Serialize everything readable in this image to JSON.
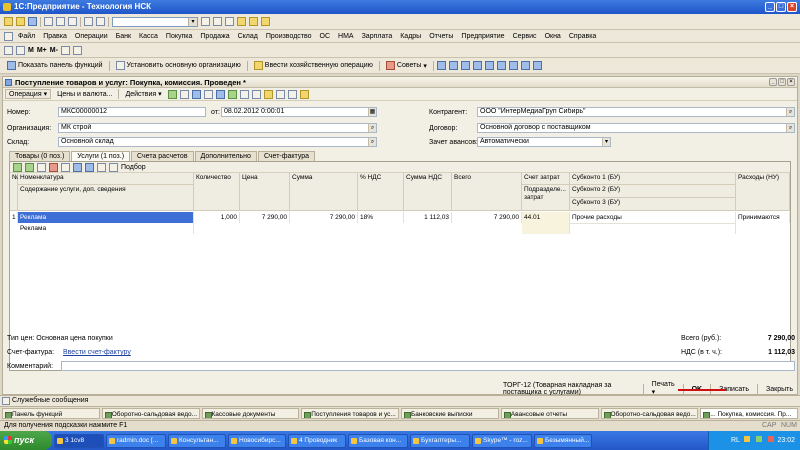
{
  "app": {
    "title": "1С:Предприятие - Технология НСК"
  },
  "menu": [
    "Файл",
    "Правка",
    "Операции",
    "Банк",
    "Касса",
    "Покупка",
    "Продажа",
    "Склад",
    "Производство",
    "ОС",
    "НМА",
    "Зарплата",
    "Кадры",
    "Отчеты",
    "Предприятие",
    "Сервис",
    "Окна",
    "Справка"
  ],
  "toolbar3": {
    "show_panel": "Показать панель функций",
    "main_org": "Установить основную организацию",
    "enter_op": "Ввести хозяйственную операцию",
    "tips": "Советы"
  },
  "doc": {
    "title": "Поступление товаров и услуг: Покупка, комиссия. Проведен *",
    "toolbar": {
      "operation": "Операция",
      "prices": "Цены и валюта...",
      "actions": "Действия"
    },
    "labels": {
      "number": "Номер:",
      "from": "от:",
      "org": "Организация:",
      "warehouse": "Склад:",
      "contractor": "Контрагент:",
      "contract": "Договор:",
      "advance": "Зачет авансов:"
    },
    "values": {
      "number": "МКС00000012",
      "date": "08.02.2012  0:00:01",
      "org": "МК строй",
      "warehouse": "Основной склад",
      "contractor": "ООО \"ИнтерМедиаГруп Сибирь\"",
      "contract": "Основной договор с поставщиком",
      "advance": "Автоматически"
    },
    "tabs": [
      "Товары (0 поз.)",
      "Услуги (1 поз.)",
      "Счета расчетов",
      "Дополнительно",
      "Счет-фактура"
    ],
    "grid_tb": {
      "pick": "Подбор"
    },
    "columns": {
      "num": "№",
      "nomen": "Номенклатура",
      "content": "Содержание услуги, доп. сведения",
      "qty": "Количество",
      "price": "Цена",
      "sum": "Сумма",
      "vat_pct": "% НДС",
      "vat_sum": "Сумма НДС",
      "total": "Всего",
      "acc": "Счет затрат",
      "sub": "Подразделе... затрат",
      "s1": "Субконто 1 (БУ)",
      "s2": "Субконто 2 (БУ)",
      "s3": "Субконто 3 (БУ)",
      "exp": "Расходы (НУ)"
    },
    "row": {
      "num": "1",
      "nomen": "Реклама",
      "content": "Реклама",
      "qty": "1,000",
      "price": "7 290,00",
      "sum": "7 290,00",
      "vat_pct": "18%",
      "vat_sum": "1 112,03",
      "total": "7 290,00",
      "acc": "44.01",
      "s1": "Прочие расходы",
      "exp": "Принимаются"
    },
    "footer": {
      "price_type": "Тип цен: Основная цена покупки",
      "invoice_lbl": "Счет-фактура:",
      "invoice_link": "Ввести счет-фактуру",
      "comment_lbl": "Комментарий:",
      "total_lbl": "Всего (руб.):",
      "total_val": "7 290,00",
      "vat_lbl": "НДС (в т. ч.):",
      "vat_val": "1 112,03"
    },
    "buttons": {
      "torg": "ТОРГ-12 (Товарная накладная за поставщика с услугами)",
      "print": "Печать",
      "ok": "OK",
      "save": "Записать",
      "close": "Закрыть"
    }
  },
  "service": "Служебные сообщения",
  "windows": [
    "Панель функций",
    "Оборотно-сальдовая ведо...",
    "Кассовые документы",
    "Поступления товаров и ус...",
    "Банковские выписки",
    "Авансовые отчеты",
    "Оборотно-сальдовая ведо...",
    "... Покупка, комиссия. Пр..."
  ],
  "status": {
    "hint": "Для получения подсказки нажмите F1",
    "cap": "CAP",
    "num": "NUM"
  },
  "taskbar": {
    "start": "пуск",
    "tasks": [
      "3 1cv8",
      "radmin.doc [...",
      "Консультан...",
      "Новосибирс...",
      "4 Проводник",
      "Базовая кон...",
      "Бухгалтеры...",
      "Skype™ - roz...",
      "Безымянный..."
    ],
    "lang": "RL",
    "clock": "23:02"
  }
}
